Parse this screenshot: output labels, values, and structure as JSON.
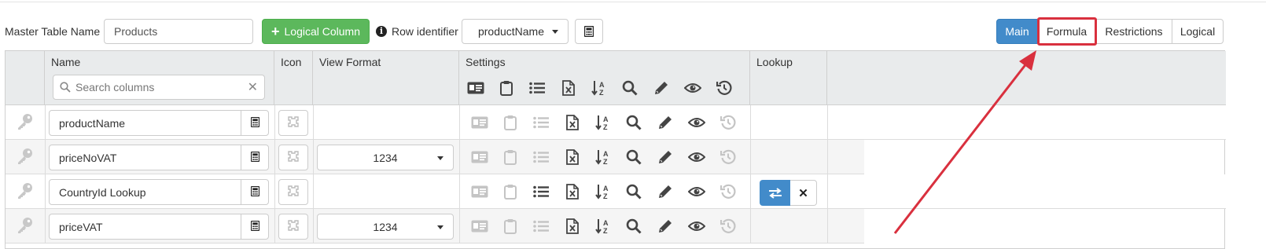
{
  "toolbar": {
    "master_table_label": "Master Table Name",
    "master_table_value": "Products",
    "add_logical_column_label": "Logical Column",
    "row_identifier_label": "Row identifier",
    "row_identifier_value": "productName"
  },
  "view_tabs": [
    {
      "label": "Main",
      "active": true
    },
    {
      "label": "Formula",
      "active": false,
      "highlighted": true
    },
    {
      "label": "Restrictions",
      "active": false
    },
    {
      "label": "Logical",
      "active": false
    }
  ],
  "grid": {
    "columns": {
      "name": "Name",
      "icon": "Icon",
      "view_format": "View Format",
      "settings": "Settings",
      "lookup": "Lookup"
    },
    "search_placeholder": "Search columns",
    "settings_icons": [
      "id-card-icon",
      "clipboard-icon",
      "list-icon",
      "excel-file-icon",
      "sort-alpha-icon",
      "search-icon",
      "pencil-icon",
      "eye-icon",
      "history-icon"
    ],
    "rows": [
      {
        "name": "productName",
        "view_format": "",
        "has_lookup": false,
        "active_settings": [
          false,
          false,
          false,
          true,
          true,
          true,
          true,
          true,
          false
        ]
      },
      {
        "name": "priceNoVAT",
        "view_format": "1234",
        "has_lookup": false,
        "active_settings": [
          false,
          false,
          false,
          true,
          true,
          true,
          true,
          true,
          false
        ]
      },
      {
        "name": "CountryId Lookup",
        "view_format": "",
        "has_lookup": true,
        "active_settings": [
          false,
          false,
          true,
          true,
          true,
          true,
          true,
          true,
          false
        ]
      },
      {
        "name": "priceVAT",
        "view_format": "1234",
        "has_lookup": false,
        "active_settings": [
          false,
          false,
          false,
          true,
          true,
          true,
          true,
          true,
          false
        ]
      }
    ]
  },
  "colors": {
    "primary": "#428bca",
    "success": "#5cb85c",
    "annotation_red": "#d9303e",
    "icon_active": "#444444",
    "icon_inactive": "#c4c4c4"
  }
}
